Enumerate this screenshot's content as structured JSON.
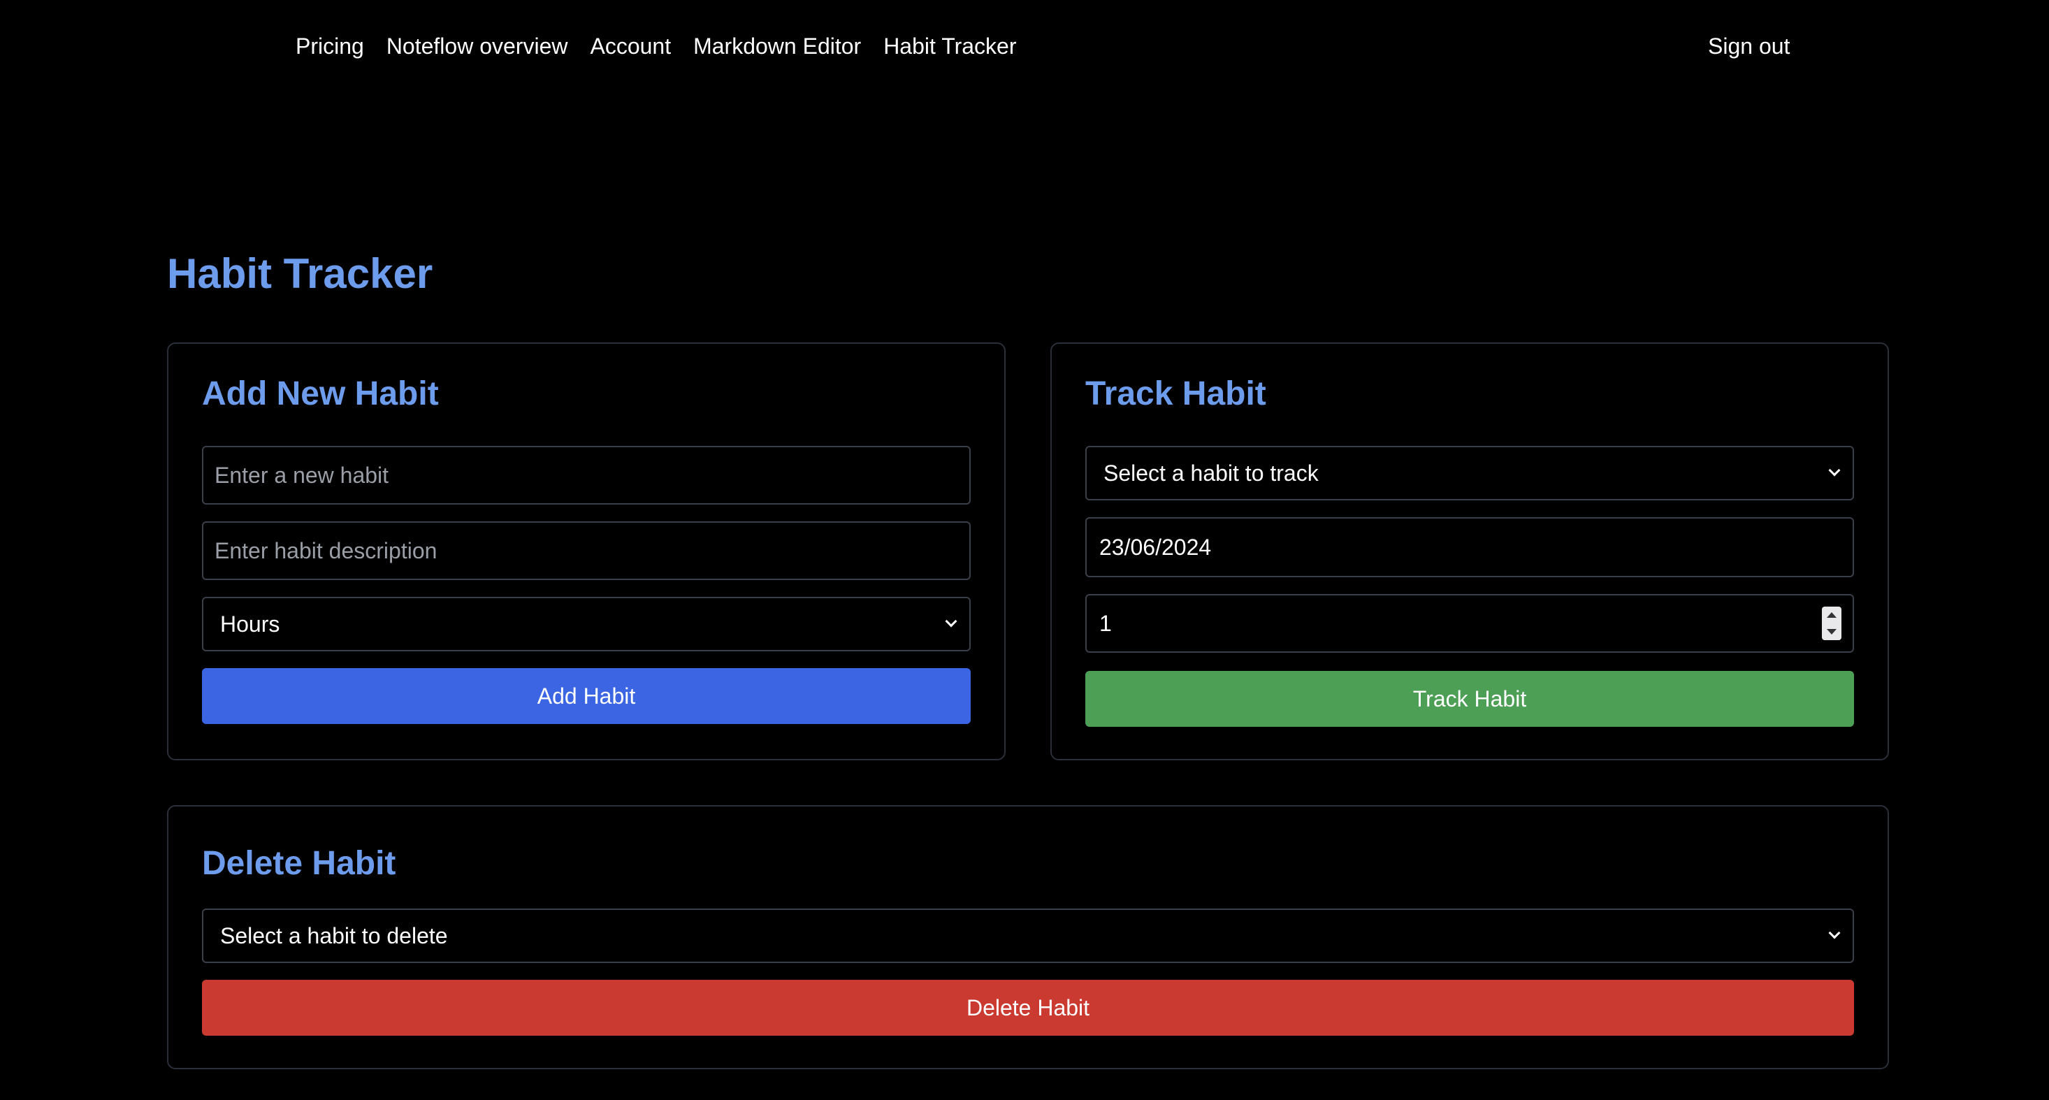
{
  "nav": {
    "links": [
      "Pricing",
      "Noteflow overview",
      "Account",
      "Markdown Editor",
      "Habit Tracker"
    ],
    "signout": "Sign out"
  },
  "page_title": "Habit Tracker",
  "add_card": {
    "title": "Add New Habit",
    "habit_placeholder": "Enter a new habit",
    "description_placeholder": "Enter habit description",
    "unit_selected": "Hours",
    "button": "Add Habit"
  },
  "track_card": {
    "title": "Track Habit",
    "habit_selected": "Select a habit to track",
    "date_value": "23/06/2024",
    "amount_value": "1",
    "button": "Track Habit"
  },
  "delete_card": {
    "title": "Delete Habit",
    "habit_selected": "Select a habit to delete",
    "button": "Delete Habit"
  },
  "colors": {
    "accent_title": "#6d9cec",
    "add_button": "#3b65e3",
    "track_button": "#4e9f56",
    "delete_button": "#ca3a31"
  }
}
